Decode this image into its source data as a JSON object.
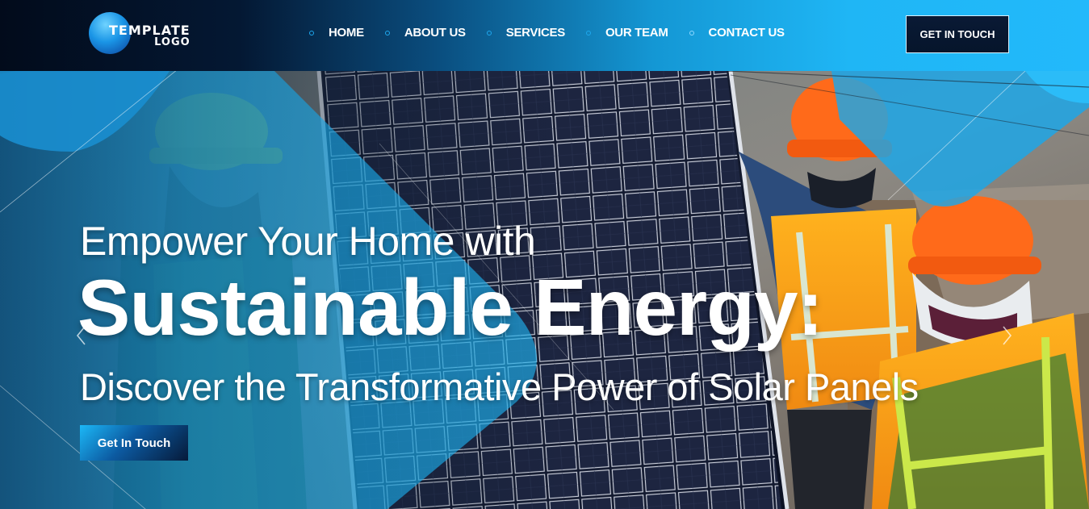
{
  "header": {
    "logo": {
      "line1": "TEMPLATE",
      "line2": "LOGO"
    },
    "nav": [
      {
        "label": "HOME"
      },
      {
        "label": "ABOUT US"
      },
      {
        "label": "SERVICES"
      },
      {
        "label": "OUR TEAM"
      },
      {
        "label": "CONTACT US"
      }
    ],
    "cta_label": "GET IN TOUCH"
  },
  "hero": {
    "line1": "Empower Your Home with",
    "line2": "Sustainable Energy:",
    "line3": "Discover the Transformative Power of Solar Panels",
    "button_label": "Get In Touch",
    "prev_icon": "chevron-left-icon",
    "next_icon": "chevron-right-icon"
  },
  "colors": {
    "accent": "#22b9fb",
    "dark": "#041833",
    "vest": "#f7a21b",
    "helmet": "#ff6a1a"
  }
}
